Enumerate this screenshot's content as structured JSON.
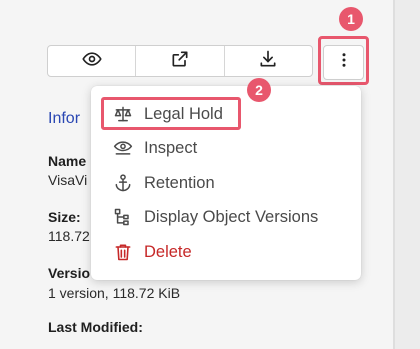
{
  "toolbar": {
    "buttons": [
      {
        "icon": "eye-icon"
      },
      {
        "icon": "share-icon"
      },
      {
        "icon": "download-icon"
      }
    ],
    "more_icon": "more-vertical-icon"
  },
  "annotations": {
    "badge_1": "1",
    "badge_2": "2",
    "highlight_color": "#e8576d"
  },
  "info": {
    "section_title": "Infor",
    "name_label": "Name",
    "name_value": "VisaVi",
    "size_label": "Size:",
    "size_value": "118.72",
    "versions_label": "Versio",
    "versions_value": "1 version, 118.72 KiB",
    "last_modified_label": "Last Modified:"
  },
  "menu": {
    "items": [
      {
        "label": "Legal Hold",
        "icon": "scale-icon"
      },
      {
        "label": "Inspect",
        "icon": "inspect-icon"
      },
      {
        "label": "Retention",
        "icon": "anchor-icon"
      },
      {
        "label": "Display Object Versions",
        "icon": "versions-tree-icon"
      },
      {
        "label": "Delete",
        "icon": "trash-icon",
        "danger_color": "#c62828"
      }
    ]
  }
}
